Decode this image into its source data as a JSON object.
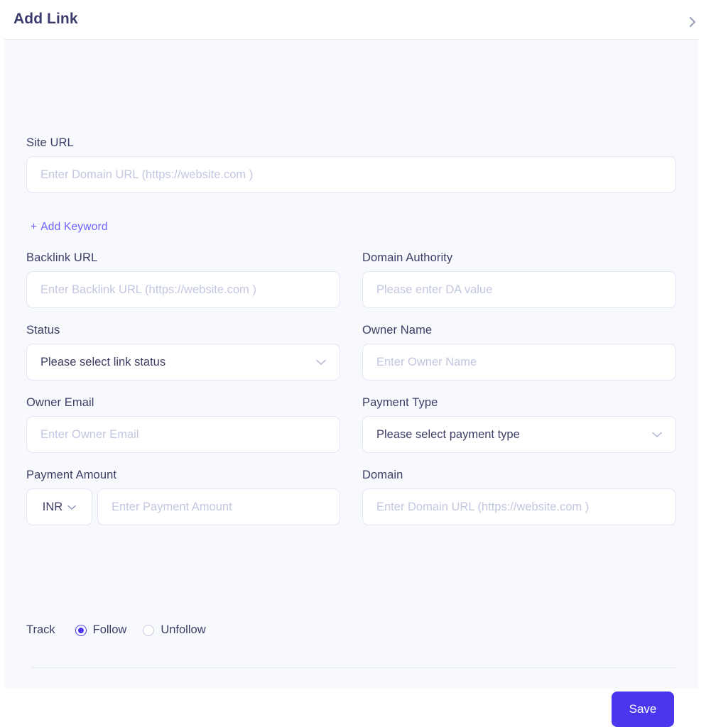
{
  "header": {
    "title": "Add Link",
    "close_icon": "chevron-right-icon"
  },
  "form": {
    "site_url": {
      "label": "Site URL",
      "placeholder": "Enter Domain URL (https://website.com )",
      "value": ""
    },
    "add_keyword": {
      "plus": "+",
      "label": "Add Keyword"
    },
    "backlink_url": {
      "label": "Backlink URL",
      "placeholder": "Enter Backlink URL (https://website.com )",
      "value": ""
    },
    "domain_authority": {
      "label": "Domain Authority",
      "placeholder": "Please enter DA value",
      "value": ""
    },
    "status": {
      "label": "Status",
      "selected": "Please select link status",
      "chevron": "chevron-down-icon"
    },
    "owner_name": {
      "label": "Owner Name",
      "placeholder": "Enter Owner Name",
      "value": ""
    },
    "owner_email": {
      "label": "Owner Email",
      "placeholder": "Enter Owner Email",
      "value": ""
    },
    "payment_type": {
      "label": "Payment Type",
      "selected": "Please select payment type",
      "chevron": "chevron-down-icon"
    },
    "payment_amount": {
      "label": "Payment Amount",
      "currency": "INR",
      "currency_chevron": "chevron-down-icon",
      "placeholder": "Enter Payment Amount",
      "value": ""
    },
    "domain": {
      "label": "Domain",
      "placeholder": "Enter Domain URL (https://website.com )",
      "value": ""
    },
    "track": {
      "label": "Track",
      "options": [
        {
          "label": "Follow",
          "selected": true
        },
        {
          "label": "Unfollow",
          "selected": false
        }
      ]
    }
  },
  "footer": {
    "save_label": "Save"
  },
  "colors": {
    "accent": "#4a36ec",
    "link": "#6c63ff",
    "title": "#3b3b6d",
    "body_bg": "#f8f9fc",
    "placeholder": "#c2c7e0"
  }
}
